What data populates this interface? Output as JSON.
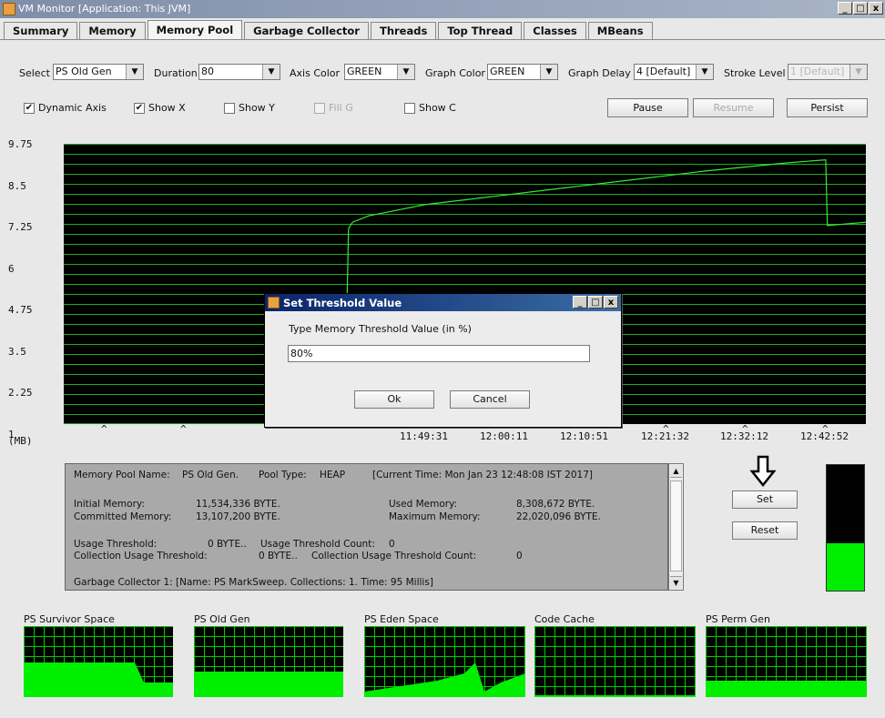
{
  "window": {
    "title": "VM Monitor [Application: This JVM]",
    "minimize": "_",
    "maximize": "□",
    "close": "x"
  },
  "tabs": [
    "Summary",
    "Memory",
    "Memory Pool",
    "Garbage Collector",
    "Threads",
    "Top Thread",
    "Classes",
    "MBeans"
  ],
  "active_tab": "Memory Pool",
  "controls": {
    "select_label": "Select",
    "select_value": "PS Old Gen",
    "duration_label": "Duration",
    "duration_value": "80",
    "axis_color_label": "Axis Color",
    "axis_color_value": "GREEN",
    "graph_color_label": "Graph Color",
    "graph_color_value": "GREEN",
    "graph_delay_label": "Graph Delay",
    "graph_delay_value": "4 [Default]",
    "stroke_level_label": "Stroke Level",
    "stroke_level_value": "1 [Default]",
    "dynamic_axis": {
      "label": "Dynamic Axis",
      "checked": true
    },
    "show_x": {
      "label": "Show X",
      "checked": true
    },
    "show_y": {
      "label": "Show Y",
      "checked": false
    },
    "fill_g": {
      "label": "Fill G",
      "checked": false
    },
    "show_c": {
      "label": "Show C",
      "checked": false
    },
    "pause": "Pause",
    "resume": "Resume",
    "persist": "Persist"
  },
  "chart_data": {
    "type": "line",
    "title": "",
    "ylabel": "(MB)",
    "xlabel": "",
    "y_ticks": [
      "9.75",
      "8.5",
      "7.25",
      "6",
      "4.75",
      "3.5",
      "2.25",
      "1"
    ],
    "ylim": [
      1,
      9.75
    ],
    "x_ticks": [
      "11:49:31",
      "12:00:11",
      "12:10:51",
      "12:21:32",
      "12:32:12",
      "12:42:52"
    ],
    "grid": true,
    "background": "#000000",
    "line_color": "#33ee33",
    "grid_color": "#22aa22",
    "series": [
      {
        "x": [
          0,
          20,
          35,
          35.5,
          36,
          38,
          40,
          42,
          45,
          50,
          55,
          60,
          65,
          70,
          75,
          80,
          86,
          90,
          95,
          95.2,
          100
        ],
        "values": [
          1,
          1,
          1,
          7.1,
          7.3,
          7.5,
          7.6,
          7.7,
          7.85,
          8.0,
          8.15,
          8.3,
          8.45,
          8.6,
          8.75,
          8.9,
          9.05,
          9.15,
          9.25,
          7.2,
          7.3
        ]
      }
    ]
  },
  "info": {
    "pool_name_label": "Memory Pool Name:",
    "pool_name": "PS Old Gen.",
    "pool_type_label": "Pool Type:",
    "pool_type": "HEAP",
    "current_time": "[Current Time: Mon Jan 23 12:48:08 IST 2017]",
    "initial_label": "Initial Memory:",
    "initial": "11,534,336 BYTE.",
    "used_label": "Used Memory:",
    "used": "8,308,672 BYTE.",
    "committed_label": "Committed Memory:",
    "committed": "13,107,200 BYTE.",
    "max_label": "Maximum Memory:",
    "max": "22,020,096 BYTE.",
    "usage_threshold_label": "Usage Threshold:",
    "usage_threshold": "0 BYTE..",
    "usage_threshold_count_label": "Usage Threshold Count:",
    "usage_threshold_count": "0",
    "collection_usage_threshold_label": "Collection Usage Threshold:",
    "collection_usage_threshold": "0 BYTE..",
    "collection_usage_threshold_count_label": "Collection Usage Threshold Count:",
    "collection_usage_threshold_count": "0",
    "gc1": "Garbage Collector 1:  [Name: PS MarkSweep. Collections: 1. Time: 95 Millis]"
  },
  "side": {
    "set": "Set",
    "reset": "Reset",
    "usage_fraction": 0.38
  },
  "dialog": {
    "title": "Set Threshold Value",
    "prompt": "Type Memory Threshold Value (in %)",
    "value": "80%",
    "ok": "Ok",
    "cancel": "Cancel"
  },
  "minis": [
    {
      "label": "PS Survivor Space"
    },
    {
      "label": "PS Old Gen"
    },
    {
      "label": "PS Eden Space"
    },
    {
      "label": "Code Cache"
    },
    {
      "label": "PS Perm Gen"
    }
  ]
}
